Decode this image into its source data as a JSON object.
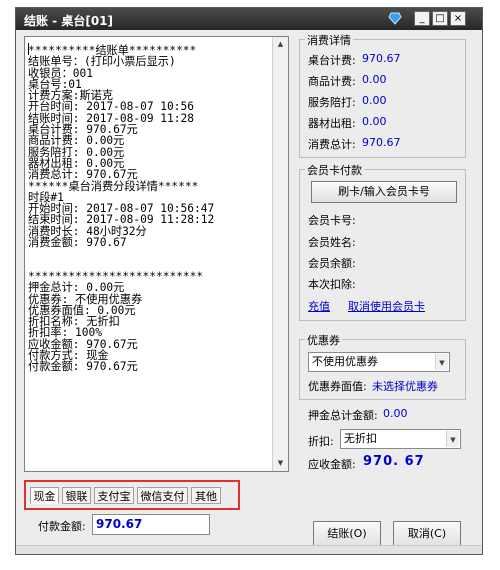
{
  "window": {
    "title": "结账 - 桌台[01]",
    "min_label": "_",
    "max_label": "□",
    "close_label": "×"
  },
  "receipt": {
    "lines": [
      "**********结账单**********",
      "结账单号：(打印小票后显示)",
      "收银员：001",
      "桌台号:01",
      "计费方案:斯诺克",
      "开台时间: 2017-08-07 10:56",
      "结账时间: 2017-08-09 11:28",
      "桌台计费: 970.67元",
      "商品计费: 0.00元",
      "服务陪打: 0.00元",
      "器材出租: 0.00元",
      "消费总计: 970.67元",
      "******桌台消费分段详情******",
      "时段#1",
      "开始时间: 2017-08-07 10:56:47",
      "结束时间: 2017-08-09 11:28:12",
      "消费时长: 48小时32分",
      "消费金额: 970.67",
      "",
      "",
      "**************************",
      "押金总计: 0.00元",
      "优惠券: 不使用优惠券",
      "优惠券面值: 0.00元",
      "折扣名称: 无折扣",
      "折扣率: 100%",
      "应收金额: 970.67元",
      "付款方式: 现金",
      "付款金额: 970.67元"
    ]
  },
  "payment_tabs": [
    "现金",
    "银联",
    "支付宝",
    "微信支付",
    "其他"
  ],
  "payment": {
    "label": "付款金额:",
    "value": "970.67"
  },
  "consumption": {
    "title": "消费详情",
    "rows": [
      {
        "label": "桌台计费:",
        "value": "970.67"
      },
      {
        "label": "商品计费:",
        "value": "0.00"
      },
      {
        "label": "服务陪打:",
        "value": "0.00"
      },
      {
        "label": "器材出租:",
        "value": "0.00"
      },
      {
        "label": "消费总计:",
        "value": "970.67"
      }
    ]
  },
  "member": {
    "title": "会员卡付款",
    "swipe_button": "刷卡/输入会员卡号",
    "rows": [
      {
        "label": "会员卡号:"
      },
      {
        "label": "会员姓名:"
      },
      {
        "label": "会员余额:"
      },
      {
        "label": "本次扣除:"
      }
    ],
    "recharge_link": "充值",
    "cancel_link": "取消使用会员卡"
  },
  "coupon": {
    "title": "优惠券",
    "selected": "不使用优惠券",
    "face_label": "优惠券面值:",
    "face_value": "未选择优惠券"
  },
  "summary": {
    "deposit_label": "押金总计金额:",
    "deposit_value": "0.00",
    "discount_label": "折扣:",
    "discount_selected": "无折扣",
    "receivable_label": "应收金额:",
    "receivable_value": "970. 67"
  },
  "buttons": {
    "checkout": "结账(O)",
    "cancel": "取消(C)"
  },
  "colors": {
    "value_blue": "#0000cc",
    "highlight_red": "#e03030",
    "titlebar": "#333333"
  }
}
